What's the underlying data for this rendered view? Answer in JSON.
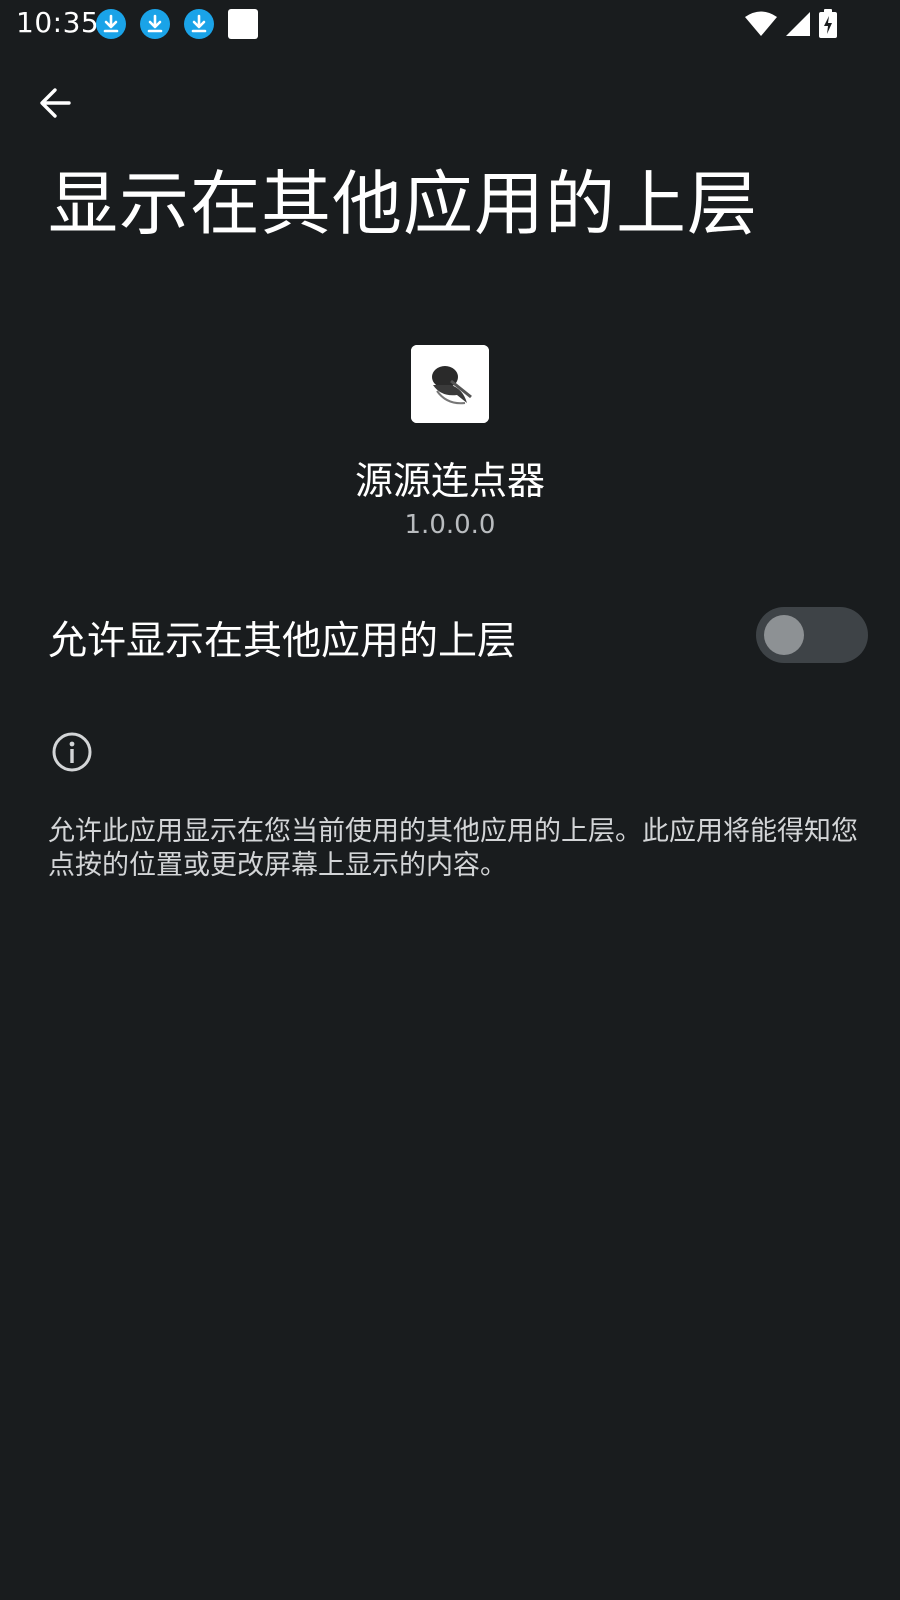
{
  "status_bar": {
    "time": "10:35",
    "notification_icons": [
      "download-icon",
      "download-icon",
      "download-icon",
      "square-icon"
    ],
    "system_icons": [
      "wifi-icon",
      "signal-icon",
      "battery-charging-icon"
    ]
  },
  "header": {
    "back_icon": "arrow-back-icon",
    "title": "显示在其他应用的上层"
  },
  "app": {
    "name": "源源连点器",
    "version": "1.0.0.0"
  },
  "permission": {
    "label": "允许显示在其他应用的上层",
    "enabled": false
  },
  "info": {
    "icon": "info-icon",
    "description": "允许此应用显示在您当前使用的其他应用的上层。此应用将能得知您点按的位置或更改屏幕上显示的内容。"
  },
  "colors": {
    "background": "#191c1e",
    "download_badge": "#1aa3e8",
    "switch_track_off": "#3e4347",
    "switch_thumb_off": "#8d9194"
  }
}
